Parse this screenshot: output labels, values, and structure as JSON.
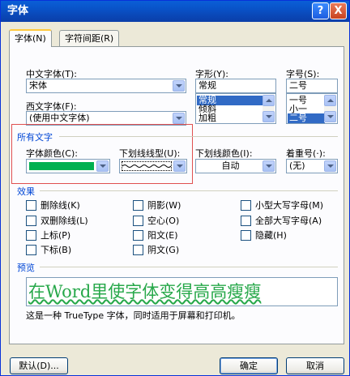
{
  "window": {
    "title": "字体",
    "help_label": "?",
    "close_label": "X"
  },
  "tabs": [
    {
      "label": "字体(N)"
    },
    {
      "label": "字符间距(R)"
    }
  ],
  "font_section": {
    "chinese_font_label": "中文字体(T):",
    "chinese_font_value": "宋体",
    "western_font_label": "西文字体(F):",
    "western_font_value": "(使用中文字体)",
    "style_label": "字形(Y):",
    "style_value": "常规",
    "style_options": [
      "常规",
      "倾斜",
      "加粗"
    ],
    "size_label": "字号(S):",
    "size_value": "二号",
    "size_options": [
      "一号",
      "小一",
      "二号"
    ]
  },
  "all_text": {
    "group_title": "所有文字",
    "font_color_label": "字体颜色(C):",
    "font_color_value": "#00b050",
    "underline_type_label": "下划线线型(U):",
    "underline_color_label": "下划线颜色(I):",
    "underline_color_value": "自动",
    "emphasis_label": "着重号(·):",
    "emphasis_value": "(无)"
  },
  "effects": {
    "group_title": "效果",
    "col1": [
      "删除线(K)",
      "双删除线(L)",
      "上标(P)",
      "下标(B)"
    ],
    "col2": [
      "阴影(W)",
      "空心(O)",
      "阳文(E)",
      "阴文(G)"
    ],
    "col3": [
      "小型大写字母(M)",
      "全部大写字母(A)",
      "隐藏(H)"
    ]
  },
  "preview": {
    "group_title": "预览",
    "sample_text": "在Word里使字体变得高高瘦瘦",
    "note": "这是一种 TrueType 字体，同时适用于屏幕和打印机。"
  },
  "buttons": {
    "default_label": "默认(D)...",
    "ok_label": "确定",
    "cancel_label": "取消"
  }
}
